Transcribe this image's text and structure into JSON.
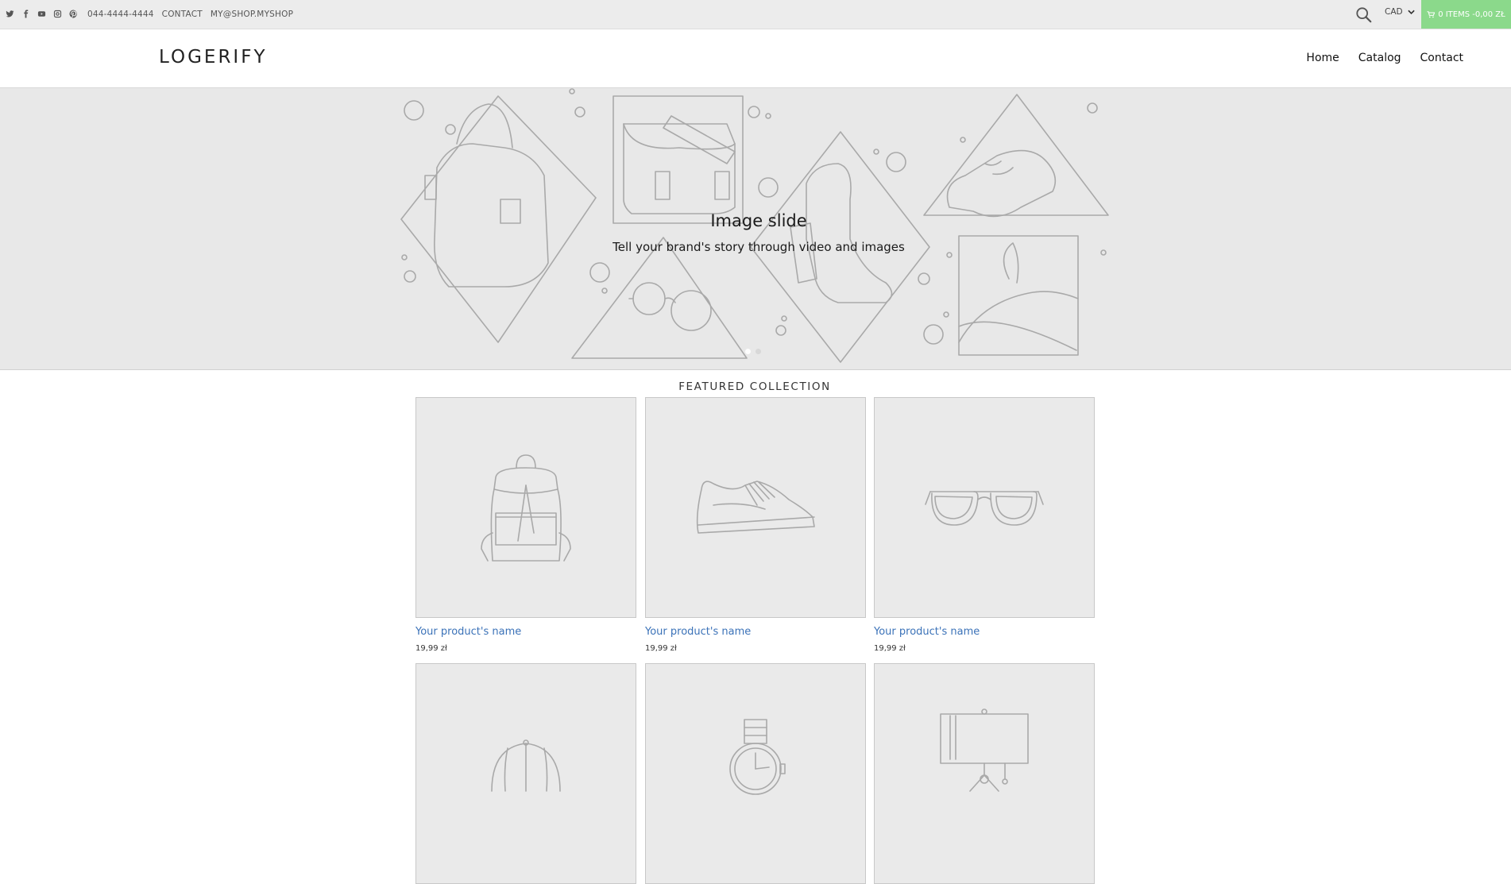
{
  "topbar": {
    "social": [
      "twitter-icon",
      "facebook-icon",
      "youtube-icon",
      "instagram-icon",
      "pinterest-icon"
    ],
    "phone": "044-4444-4444",
    "contact": "CONTACT",
    "email": "MY@SHOP.MYSHOP",
    "currency": "CAD",
    "cart_label": "0 ITEMS -0,00 ZŁ",
    "cart_color": "#8bd98b"
  },
  "header": {
    "logo": "LOGERIFY",
    "nav": [
      "Home",
      "Catalog",
      "Contact"
    ]
  },
  "hero": {
    "title": "Image slide",
    "subtitle": "Tell your brand's story through video and images",
    "slides": 2,
    "active_slide": 1
  },
  "featured": {
    "title": "FEATURED COLLECTION",
    "products": [
      {
        "name": "Your product's name",
        "price": "19,99 zł",
        "icon": "backpack-icon"
      },
      {
        "name": "Your product's name",
        "price": "19,99 zł",
        "icon": "sneaker-icon"
      },
      {
        "name": "Your product's name",
        "price": "19,99 zł",
        "icon": "sunglasses-icon"
      },
      {
        "name": "",
        "price": "",
        "icon": "cap-icon"
      },
      {
        "name": "",
        "price": "",
        "icon": "watch-icon"
      },
      {
        "name": "",
        "price": "",
        "icon": "easel-icon"
      }
    ]
  },
  "link_color": "#3b72b8"
}
